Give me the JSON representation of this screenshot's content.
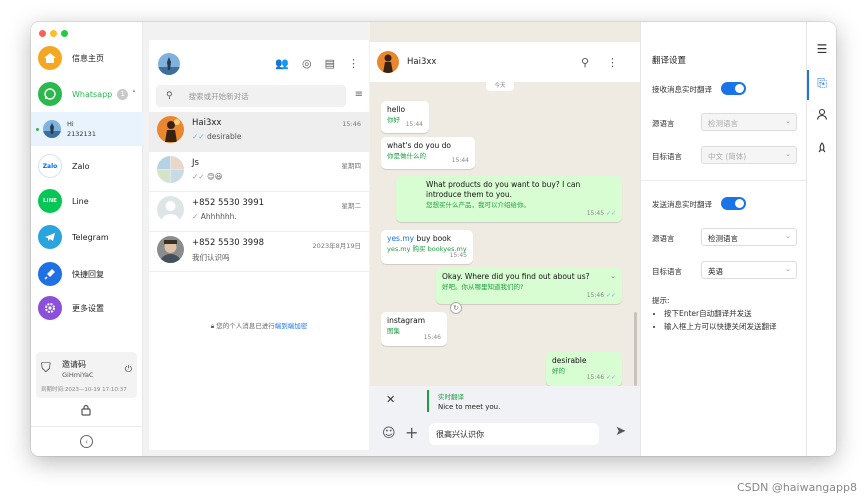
{
  "sidebar": {
    "home": "信息主页",
    "whatsapp": "Whatsapp",
    "whatsapp_count": "1",
    "account_name": "Hi",
    "account_id": "2132131",
    "zalo": "Zalo",
    "zalo_icon": "Zalo",
    "line": "Line",
    "line_icon": "LINE",
    "telegram": "Telegram",
    "quick_reply": "快捷回复",
    "more_settings": "更多设置",
    "invite_label": "邀请码",
    "invite_code": "GiHmiYaC",
    "expire": "到期时间:2023—10-19 17:10:37"
  },
  "chatlist": {
    "search_placeholder": "搜索或开始新对话",
    "chats": [
      {
        "name": "Hai3xx",
        "preview": "desirable",
        "time": "15:46"
      },
      {
        "name": "Js",
        "preview": "😊😃",
        "time": "星期四"
      },
      {
        "name": "+852 5530 3991",
        "preview": "Ahhhhhh.",
        "time": "星期二"
      },
      {
        "name": "+852 5530 3998",
        "preview": "我们认识吗",
        "time": "2023年8月19日"
      }
    ],
    "e2e_text": "您的个人消息已进行",
    "e2e_link": "端到端加密"
  },
  "conversation": {
    "name": "Hai3xx",
    "date_chip": "今天",
    "messages": [
      {
        "dir": "in",
        "text": "hello",
        "trans": "你好",
        "time": "15:44"
      },
      {
        "dir": "in",
        "text": "what's do you do",
        "trans": "你是做什么的",
        "time": "15:44"
      },
      {
        "dir": "out",
        "text": "What products do you want to buy? I can introduce them to you.",
        "trans": "您想买什么产品，我可以介绍给你。",
        "time": "15:45"
      },
      {
        "dir": "in",
        "text_link": "yes.my",
        "text": " buy book",
        "trans": "yes.my 购买 bookyes.my",
        "time": "15:45"
      },
      {
        "dir": "out",
        "text": "Okay. Where did you find out about us?",
        "trans": "好吧。你从哪里知道我们的?",
        "time": "15:46"
      },
      {
        "dir": "in",
        "text": "instagram",
        "trans": "图集",
        "time": "15:46"
      },
      {
        "dir": "out",
        "text": "desirable",
        "trans": "好的",
        "time": "15:46"
      }
    ],
    "realtime_label": "实时翻译",
    "realtime_value": "Nice to meet you.",
    "input_value": "很高兴认识你"
  },
  "translate": {
    "title": "翻译设置",
    "recv_label": "接收消息实时翻译",
    "source_label": "源语言",
    "recv_source": "检测语言",
    "target_label": "目标语言",
    "recv_target": "中文 (简体)",
    "send_label": "发送消息实时翻译",
    "send_source": "检测语言",
    "send_target": "英语",
    "tips_title": "提示:",
    "tip1": "按下Enter自动翻译并发送",
    "tip2": "输入框上方可以快捷关闭发送翻译"
  },
  "watermark": "CSDN @haiwangapp8",
  "colors": {
    "accent": "#1a73e8",
    "whatsapp": "#2bb84c",
    "out_bubble": "#d9fdd3"
  }
}
